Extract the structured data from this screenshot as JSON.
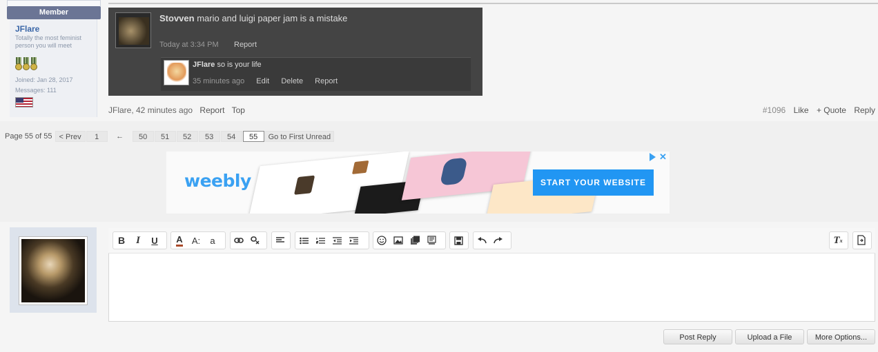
{
  "author": {
    "badge": "Member",
    "name": "JFlare",
    "title": "Totally the most feminist person you will meet",
    "joined": "Joined: Jan 28, 2017",
    "messages": "Messages: 111"
  },
  "post": {
    "username": "Stovven",
    "text": "mario and luigi paper jam is a mistake",
    "time": "Today at 3:34 PM",
    "report": "Report",
    "reply": {
      "username": "JFlare",
      "text": "so is your life",
      "time": "35 minutes ago",
      "edit": "Edit",
      "delete": "Delete",
      "report": "Report"
    },
    "footer": {
      "meta": "JFlare, 42 minutes ago",
      "report": "Report",
      "top": "Top",
      "number": "#1096",
      "like": "Like",
      "quote": "+ Quote",
      "reply": "Reply"
    }
  },
  "pagination": {
    "label": "Page 55 of 55",
    "prev": "< Prev",
    "first": "1",
    "ellipsis": "←",
    "pages": [
      "50",
      "51",
      "52",
      "53",
      "54",
      "55"
    ],
    "goto_unread": "Go to First Unread"
  },
  "ad": {
    "logo": "weebly",
    "cta": "START YOUR WEBSITE",
    "close": "✕"
  },
  "toolbar": {
    "bold": "B",
    "italic": "I",
    "underline": "U",
    "color": "A",
    "size": "A:",
    "font": "a",
    "remove_format": "T"
  },
  "buttons": {
    "post_reply": "Post Reply",
    "upload": "Upload a File",
    "more": "More Options..."
  },
  "colors": {
    "accent": "#3a66a7",
    "ad_blue": "#2196f3",
    "dark_post": "#444444"
  }
}
